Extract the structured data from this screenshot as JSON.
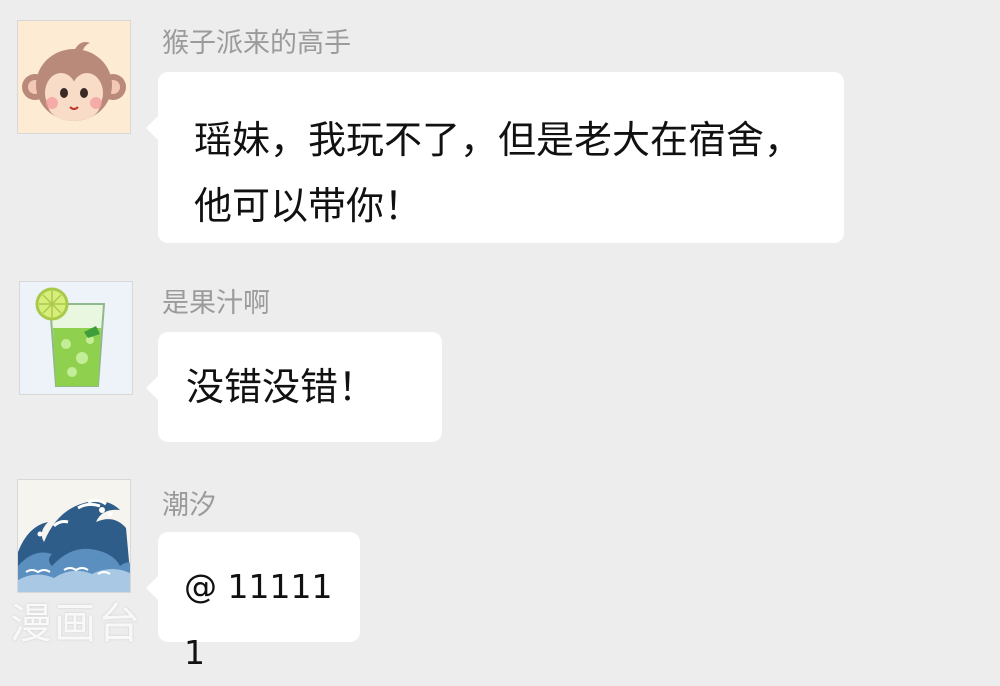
{
  "messages": [
    {
      "sender": "猴子派来的高手",
      "avatar_icon": "monkey-face-icon",
      "text": "瑶妹，我玩不了，但是老大在宿舍，他可以带你！"
    },
    {
      "sender": "是果汁啊",
      "avatar_icon": "lime-juice-glass-icon",
      "text": "没错没错！"
    },
    {
      "sender": "潮汐",
      "avatar_icon": "ocean-wave-icon",
      "text": "@ 111111"
    }
  ],
  "watermark": "漫画台",
  "colors": {
    "background": "#ededed",
    "bubble": "#ffffff",
    "name_text": "#9b9b9b",
    "message_text": "#111111"
  }
}
